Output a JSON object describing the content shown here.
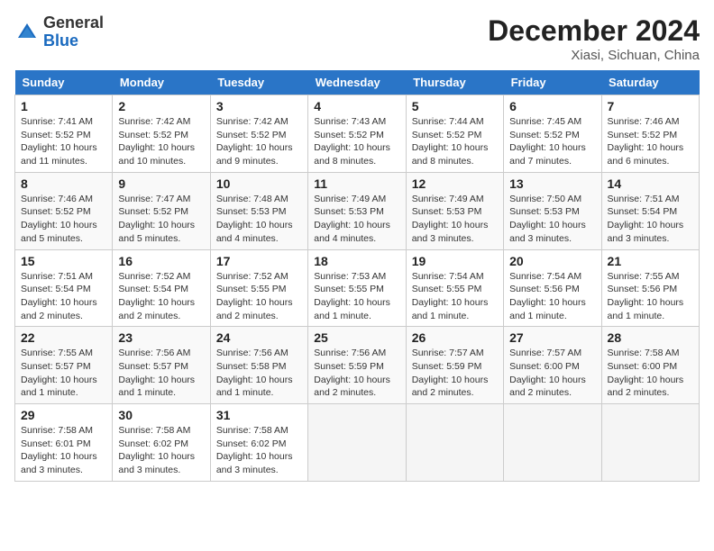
{
  "header": {
    "logo_general": "General",
    "logo_blue": "Blue",
    "month_title": "December 2024",
    "location": "Xiasi, Sichuan, China"
  },
  "weekdays": [
    "Sunday",
    "Monday",
    "Tuesday",
    "Wednesday",
    "Thursday",
    "Friday",
    "Saturday"
  ],
  "weeks": [
    [
      {
        "day": "1",
        "detail": "Sunrise: 7:41 AM\nSunset: 5:52 PM\nDaylight: 10 hours\nand 11 minutes."
      },
      {
        "day": "2",
        "detail": "Sunrise: 7:42 AM\nSunset: 5:52 PM\nDaylight: 10 hours\nand 10 minutes."
      },
      {
        "day": "3",
        "detail": "Sunrise: 7:42 AM\nSunset: 5:52 PM\nDaylight: 10 hours\nand 9 minutes."
      },
      {
        "day": "4",
        "detail": "Sunrise: 7:43 AM\nSunset: 5:52 PM\nDaylight: 10 hours\nand 8 minutes."
      },
      {
        "day": "5",
        "detail": "Sunrise: 7:44 AM\nSunset: 5:52 PM\nDaylight: 10 hours\nand 8 minutes."
      },
      {
        "day": "6",
        "detail": "Sunrise: 7:45 AM\nSunset: 5:52 PM\nDaylight: 10 hours\nand 7 minutes."
      },
      {
        "day": "7",
        "detail": "Sunrise: 7:46 AM\nSunset: 5:52 PM\nDaylight: 10 hours\nand 6 minutes."
      }
    ],
    [
      {
        "day": "8",
        "detail": "Sunrise: 7:46 AM\nSunset: 5:52 PM\nDaylight: 10 hours\nand 5 minutes."
      },
      {
        "day": "9",
        "detail": "Sunrise: 7:47 AM\nSunset: 5:52 PM\nDaylight: 10 hours\nand 5 minutes."
      },
      {
        "day": "10",
        "detail": "Sunrise: 7:48 AM\nSunset: 5:53 PM\nDaylight: 10 hours\nand 4 minutes."
      },
      {
        "day": "11",
        "detail": "Sunrise: 7:49 AM\nSunset: 5:53 PM\nDaylight: 10 hours\nand 4 minutes."
      },
      {
        "day": "12",
        "detail": "Sunrise: 7:49 AM\nSunset: 5:53 PM\nDaylight: 10 hours\nand 3 minutes."
      },
      {
        "day": "13",
        "detail": "Sunrise: 7:50 AM\nSunset: 5:53 PM\nDaylight: 10 hours\nand 3 minutes."
      },
      {
        "day": "14",
        "detail": "Sunrise: 7:51 AM\nSunset: 5:54 PM\nDaylight: 10 hours\nand 3 minutes."
      }
    ],
    [
      {
        "day": "15",
        "detail": "Sunrise: 7:51 AM\nSunset: 5:54 PM\nDaylight: 10 hours\nand 2 minutes."
      },
      {
        "day": "16",
        "detail": "Sunrise: 7:52 AM\nSunset: 5:54 PM\nDaylight: 10 hours\nand 2 minutes."
      },
      {
        "day": "17",
        "detail": "Sunrise: 7:52 AM\nSunset: 5:55 PM\nDaylight: 10 hours\nand 2 minutes."
      },
      {
        "day": "18",
        "detail": "Sunrise: 7:53 AM\nSunset: 5:55 PM\nDaylight: 10 hours\nand 1 minute."
      },
      {
        "day": "19",
        "detail": "Sunrise: 7:54 AM\nSunset: 5:55 PM\nDaylight: 10 hours\nand 1 minute."
      },
      {
        "day": "20",
        "detail": "Sunrise: 7:54 AM\nSunset: 5:56 PM\nDaylight: 10 hours\nand 1 minute."
      },
      {
        "day": "21",
        "detail": "Sunrise: 7:55 AM\nSunset: 5:56 PM\nDaylight: 10 hours\nand 1 minute."
      }
    ],
    [
      {
        "day": "22",
        "detail": "Sunrise: 7:55 AM\nSunset: 5:57 PM\nDaylight: 10 hours\nand 1 minute."
      },
      {
        "day": "23",
        "detail": "Sunrise: 7:56 AM\nSunset: 5:57 PM\nDaylight: 10 hours\nand 1 minute."
      },
      {
        "day": "24",
        "detail": "Sunrise: 7:56 AM\nSunset: 5:58 PM\nDaylight: 10 hours\nand 1 minute."
      },
      {
        "day": "25",
        "detail": "Sunrise: 7:56 AM\nSunset: 5:59 PM\nDaylight: 10 hours\nand 2 minutes."
      },
      {
        "day": "26",
        "detail": "Sunrise: 7:57 AM\nSunset: 5:59 PM\nDaylight: 10 hours\nand 2 minutes."
      },
      {
        "day": "27",
        "detail": "Sunrise: 7:57 AM\nSunset: 6:00 PM\nDaylight: 10 hours\nand 2 minutes."
      },
      {
        "day": "28",
        "detail": "Sunrise: 7:58 AM\nSunset: 6:00 PM\nDaylight: 10 hours\nand 2 minutes."
      }
    ],
    [
      {
        "day": "29",
        "detail": "Sunrise: 7:58 AM\nSunset: 6:01 PM\nDaylight: 10 hours\nand 3 minutes."
      },
      {
        "day": "30",
        "detail": "Sunrise: 7:58 AM\nSunset: 6:02 PM\nDaylight: 10 hours\nand 3 minutes."
      },
      {
        "day": "31",
        "detail": "Sunrise: 7:58 AM\nSunset: 6:02 PM\nDaylight: 10 hours\nand 3 minutes."
      },
      {
        "day": "",
        "detail": ""
      },
      {
        "day": "",
        "detail": ""
      },
      {
        "day": "",
        "detail": ""
      },
      {
        "day": "",
        "detail": ""
      }
    ]
  ]
}
